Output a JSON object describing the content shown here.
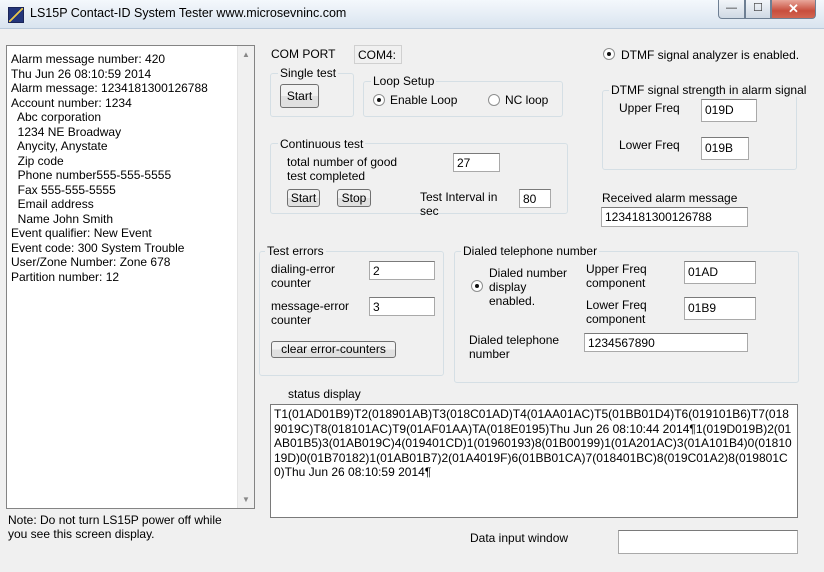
{
  "window": {
    "title": "LS15P Contact-ID System Tester   www.microsevninc.com",
    "min_glyph": "—",
    "max_glyph": "☐",
    "close_glyph": "✕"
  },
  "log": {
    "lines": [
      "Alarm message number:  420",
      "Thu Jun 26 08:10:59 2014",
      "Alarm message:  1234181300126788",
      "Account number:  1234",
      "  Abc corporation",
      "  1234 NE Broadway",
      "  Anycity, Anystate",
      "  Zip code",
      "  Phone number555-555-5555",
      "  Fax 555-555-5555",
      "  Email address",
      "  Name John Smith",
      "Event qualifier:  New Event",
      "Event code:  300  System Trouble",
      "User/Zone Number:  Zone 678",
      "Partition number:  12"
    ],
    "scroll_up": "▲",
    "scroll_down": "▼"
  },
  "note": "Note: Do not turn LS15P power off while you see this screen display.",
  "com_port": {
    "label": "COM PORT",
    "value": "COM4:"
  },
  "single_test": {
    "title": "Single test",
    "start": "Start"
  },
  "loop_setup": {
    "title": "Loop Setup",
    "enable_loop": "Enable Loop",
    "nc_loop": "NC loop",
    "selected": "enable_loop"
  },
  "continuous_test": {
    "title": "Continuous test",
    "good_label_1": "total number of good",
    "good_label_2": "test completed",
    "good_value": "27",
    "start": "Start",
    "stop": "Stop",
    "interval_label_1": "Test Interval in",
    "interval_label_2": "sec",
    "interval_value": "80"
  },
  "dtmf": {
    "analyzer_label": "DTMF signal analyzer is enabled.",
    "analyzer_enabled": true,
    "strength_title": "DTMF signal strength in alarm signal",
    "upper_label": "Upper Freq",
    "upper_value": "019D",
    "lower_label": "Lower Freq",
    "lower_value": "019B"
  },
  "received": {
    "label": "Received alarm message",
    "value": "1234181300126788"
  },
  "test_errors": {
    "title": "Test errors",
    "dialing_label_1": "dialing-error",
    "dialing_label_2": "counter",
    "dialing_value": "2",
    "message_label_1": "message-error",
    "message_label_2": "counter",
    "message_value": "3",
    "clear_button": "clear error-counters"
  },
  "dialed": {
    "title": "Dialed telephone number",
    "display_label_1": "Dialed number",
    "display_label_2": "display",
    "display_label_3": "enabled.",
    "display_enabled": true,
    "upper_label_1": "Upper Freq",
    "upper_label_2": "component",
    "upper_value": "01AD",
    "lower_label_1": "Lower Freq",
    "lower_label_2": "component",
    "lower_value": "01B9",
    "number_label_1": "Dialed telephone",
    "number_label_2": "number",
    "number_value": "1234567890"
  },
  "status": {
    "label": "status display",
    "text": "T1(01AD01B9)T2(018901AB)T3(018C01AD)T4(01AA01AC)T5(01BB01D4)T6(019101B6)T7(0189019C)T8(018101AC)T9(01AF01AA)TA(018E0195)Thu Jun 26 08:10:44 2014¶1(019D019B)2(01AB01B5)3(01AB019C)4(019401CD)1(01960193)8(01B00199)1(01A201AC)3(01A101B4)0(0181019D)0(01B70182)1(01AB01B7)2(01A4019F)6(01BB01CA)7(018401BC)8(019C01A2)8(019801C0)Thu Jun 26 08:10:59 2014¶"
  },
  "data_input": {
    "label": "Data input window",
    "value": ""
  }
}
